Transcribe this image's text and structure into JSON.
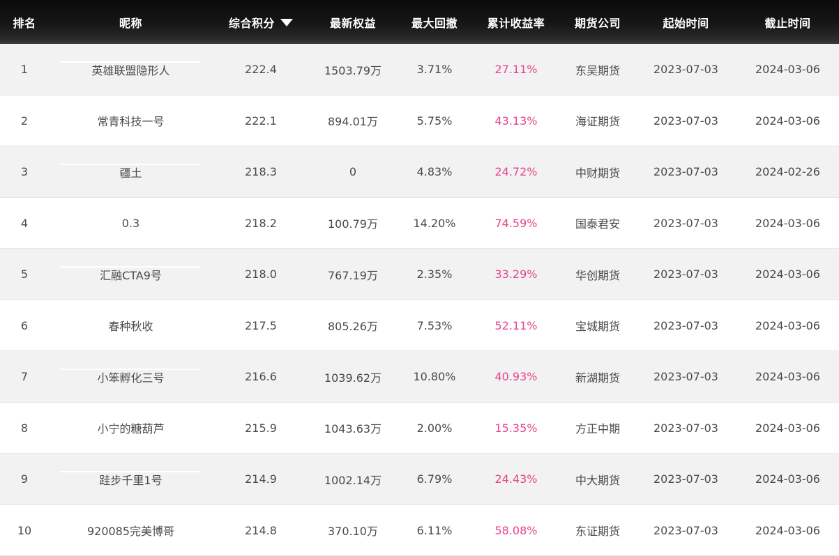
{
  "table": {
    "headers": {
      "rank": "排名",
      "nickname": "昵称",
      "score": "综合积分",
      "equity": "最新权益",
      "drawdown": "最大回撤",
      "yield": "累计收益率",
      "company": "期货公司",
      "start": "起始时间",
      "end": "截止时间"
    },
    "sort": {
      "column": "综合积分",
      "direction": "descending",
      "icon": "sort-down-icon"
    },
    "colors": {
      "header_background": "#111111",
      "yield_text": "#e8438a",
      "row_stripe": "#f2f2f2"
    },
    "rows": [
      {
        "rank": "1",
        "nickname": "英雄联盟隐形人",
        "score": "222.4",
        "equity": "1503.79万",
        "drawdown": "3.71%",
        "yield": "27.11%",
        "company": "东吴期货",
        "start": "2023-07-03",
        "end": "2024-03-06"
      },
      {
        "rank": "2",
        "nickname": "常青科技一号",
        "score": "222.1",
        "equity": "894.01万",
        "drawdown": "5.75%",
        "yield": "43.13%",
        "company": "海证期货",
        "start": "2023-07-03",
        "end": "2024-03-06"
      },
      {
        "rank": "3",
        "nickname": "疆土",
        "score": "218.3",
        "equity": "0",
        "drawdown": "4.83%",
        "yield": "24.72%",
        "company": "中财期货",
        "start": "2023-07-03",
        "end": "2024-02-26"
      },
      {
        "rank": "4",
        "nickname": "0.3",
        "score": "218.2",
        "equity": "100.79万",
        "drawdown": "14.20%",
        "yield": "74.59%",
        "company": "国泰君安",
        "start": "2023-07-03",
        "end": "2024-03-06"
      },
      {
        "rank": "5",
        "nickname": "汇融CTA9号",
        "score": "218.0",
        "equity": "767.19万",
        "drawdown": "2.35%",
        "yield": "33.29%",
        "company": "华创期货",
        "start": "2023-07-03",
        "end": "2024-03-06"
      },
      {
        "rank": "6",
        "nickname": "春种秋收",
        "score": "217.5",
        "equity": "805.26万",
        "drawdown": "7.53%",
        "yield": "52.11%",
        "company": "宝城期货",
        "start": "2023-07-03",
        "end": "2024-03-06"
      },
      {
        "rank": "7",
        "nickname": "小笨孵化三号",
        "score": "216.6",
        "equity": "1039.62万",
        "drawdown": "10.80%",
        "yield": "40.93%",
        "company": "新湖期货",
        "start": "2023-07-03",
        "end": "2024-03-06"
      },
      {
        "rank": "8",
        "nickname": "小宁的糖葫芦",
        "score": "215.9",
        "equity": "1043.63万",
        "drawdown": "2.00%",
        "yield": "15.35%",
        "company": "方正中期",
        "start": "2023-07-03",
        "end": "2024-03-06"
      },
      {
        "rank": "9",
        "nickname": "跬步千里1号",
        "score": "214.9",
        "equity": "1002.14万",
        "drawdown": "6.79%",
        "yield": "24.43%",
        "company": "中大期货",
        "start": "2023-07-03",
        "end": "2024-03-06"
      },
      {
        "rank": "10",
        "nickname": "920085完美博哥",
        "score": "214.8",
        "equity": "370.10万",
        "drawdown": "6.11%",
        "yield": "58.08%",
        "company": "东证期货",
        "start": "2023-07-03",
        "end": "2024-03-06"
      }
    ]
  }
}
